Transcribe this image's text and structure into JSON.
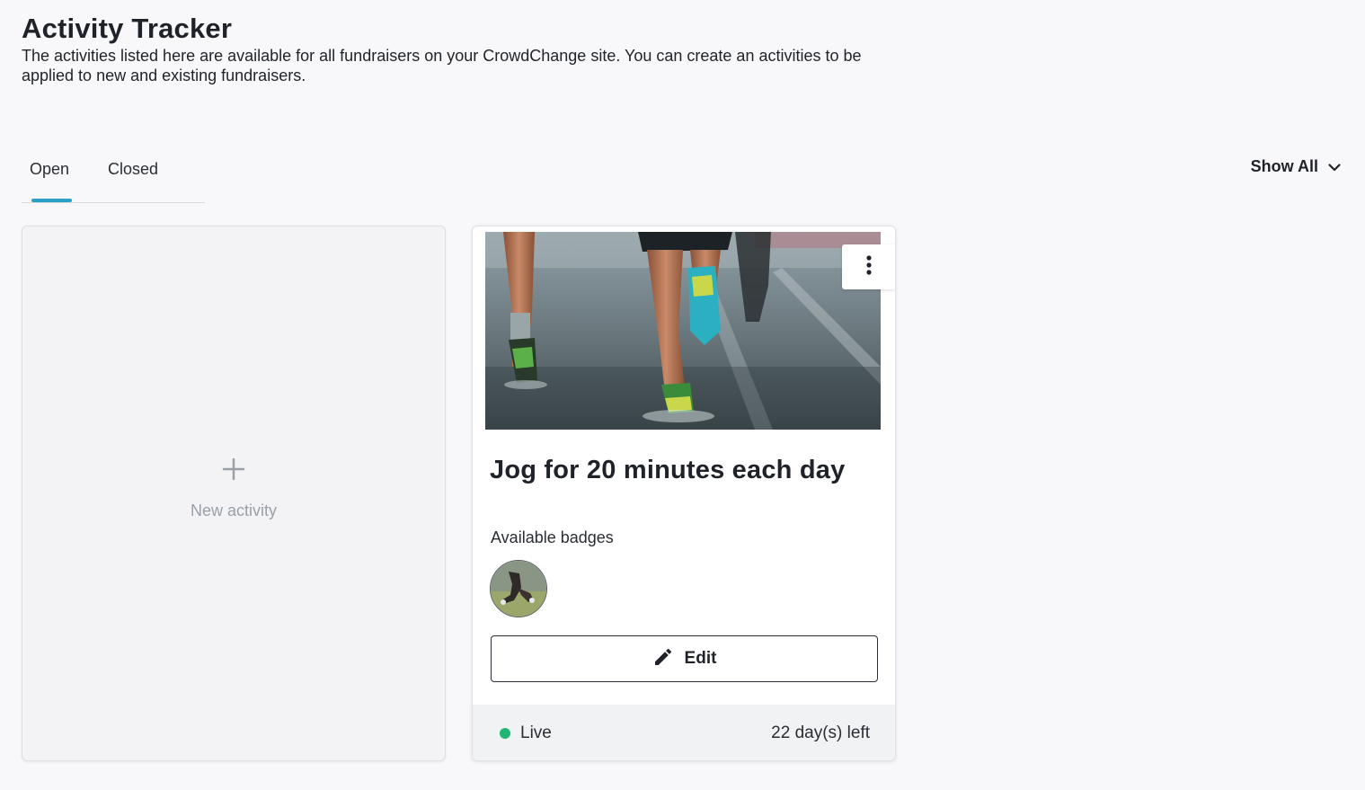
{
  "header": {
    "title": "Activity Tracker",
    "description": "The activities listed here are available for all fundraisers on your CrowdChange site. You can create an activities to be applied to new and existing fundraisers."
  },
  "tabs": {
    "open_label": "Open",
    "closed_label": "Closed",
    "active": "Open"
  },
  "filter": {
    "label": "Show All",
    "icon": "chevron-down-icon"
  },
  "new_activity": {
    "icon": "plus-icon",
    "label": "New activity"
  },
  "activity": {
    "title": "Jog for 20 minutes each day",
    "image_alt": "runners legs on wet road",
    "menu_icon": "more-vertical-icon",
    "badges_label": "Available badges",
    "edit_label": "Edit",
    "edit_icon": "pencil-icon",
    "status": "Live",
    "status_color": "#21b573",
    "time_left": "22 day(s) left"
  },
  "colors": {
    "accent": "#2aa0c7",
    "background": "#f8f8fa"
  }
}
